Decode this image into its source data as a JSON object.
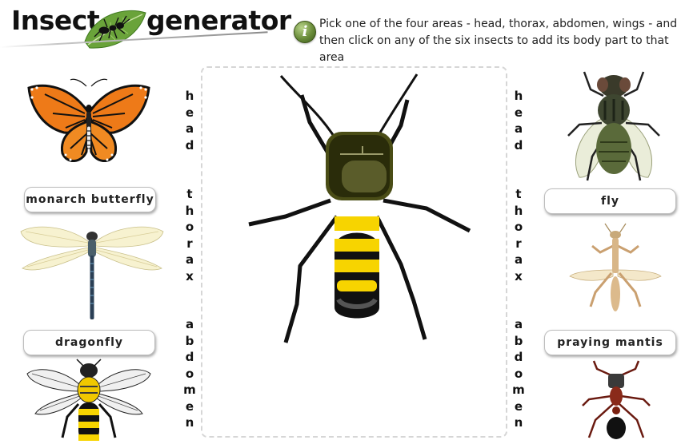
{
  "header": {
    "title_word1": "Insect",
    "title_word2": "generator",
    "logo_icon": "ant-on-leaf-icon"
  },
  "info": {
    "icon": "info-icon",
    "icon_glyph": "i",
    "text": "Pick one of the four areas - head, thorax, abdomen, wings - and then click on any of the six insects to add its body part to that area"
  },
  "areas": {
    "head": [
      "h",
      "e",
      "a",
      "d"
    ],
    "thorax": [
      "t",
      "h",
      "o",
      "r",
      "a",
      "x"
    ],
    "abdomen": [
      "a",
      "b",
      "d",
      "o",
      "m",
      "e",
      "n"
    ]
  },
  "insects": {
    "monarch_butterfly": "monarch butterfly",
    "dragonfly": "dragonfly",
    "fly": "fly",
    "praying_mantis": "praying mantis",
    "wasp_icon": "wasp-icon",
    "ant_icon": "ant-icon"
  },
  "colors": {
    "info_green": "#6a8c3a",
    "canvas_border": "#d6d6d6",
    "label_border": "#bdbdbd"
  }
}
